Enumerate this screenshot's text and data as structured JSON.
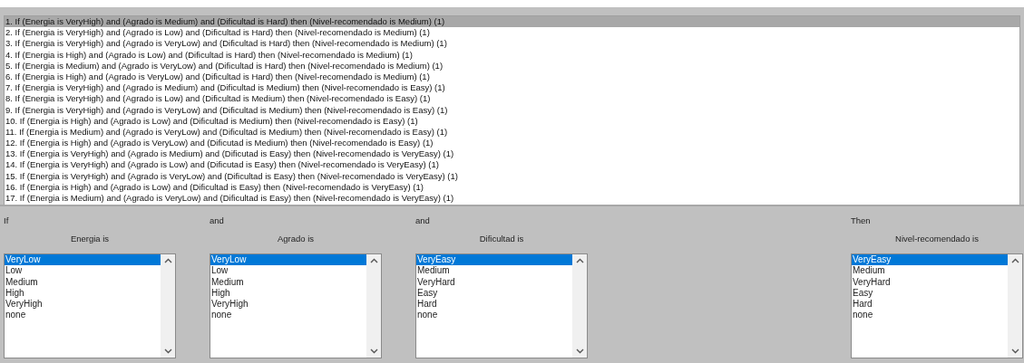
{
  "rules": [
    {
      "text": "1. If (Energia is VeryHigh) and (Agrado is Medium) and (Dificultad is Hard) then (Nivel-recomendado is Medium) (1)",
      "selected": true
    },
    {
      "text": "2. If (Energia is VeryHigh) and (Agrado is Low) and (Dificultad is Hard) then (Nivel-recomendado is Medium) (1)",
      "selected": false
    },
    {
      "text": "3. If (Energia is VeryHigh) and (Agrado is VeryLow) and (Dificultad is Hard) then (Nivel-recomendado is Medium) (1)",
      "selected": false
    },
    {
      "text": "4. If (Energia is High) and (Agrado is Low) and (Dificultad is Hard) then (Nivel-recomendado is Medium) (1)",
      "selected": false
    },
    {
      "text": "5. If (Energia is Medium) and (Agrado is VeryLow) and (Dificultad is Hard) then (Nivel-recomendado is Medium) (1)",
      "selected": false
    },
    {
      "text": "6. If (Energia is High) and (Agrado is VeryLow) and (Dificultad is Hard) then (Nivel-recomendado is Medium) (1)",
      "selected": false
    },
    {
      "text": "7. If (Energia is VeryHigh) and (Agrado is Medium) and (Dificultad is Medium) then (Nivel-recomendado is Easy) (1)",
      "selected": false
    },
    {
      "text": "8. If (Energia is VeryHigh) and (Agrado is Low) and (Dificultad is Medium) then (Nivel-recomendado is Easy) (1)",
      "selected": false
    },
    {
      "text": "9. If (Energia is VeryHigh) and (Agrado is VeryLow) and (Dificultad is Medium) then (Nivel-recomendado is Easy) (1)",
      "selected": false
    },
    {
      "text": "10. If (Energia is High) and (Agrado is Low) and (Dificultad is Medium) then (Nivel-recomendado is Easy) (1)",
      "selected": false
    },
    {
      "text": "11. If (Energia is Medium) and (Agrado is VeryLow) and (Dificultad is Medium) then (Nivel-recomendado is Easy) (1)",
      "selected": false
    },
    {
      "text": "12. If (Energia is High) and (Agrado is VeryLow) and (Dificutad is Medium) then (Nivel-recomendado is Easy) (1)",
      "selected": false
    },
    {
      "text": "13. If (Energia is VeryHigh) and (Agrado is Medium) and (Dificutad is Easy) then (Nivel-recomendado is VeryEasy) (1)",
      "selected": false
    },
    {
      "text": "14. If (Energia is VeryHigh) and (Agrado is Low) and (Dificutad is Easy) then (Nivel-recomendado is VeryEasy) (1)",
      "selected": false
    },
    {
      "text": "15. If (Energia is VeryHigh) and (Agrado is VeryLow) and (Dificultad is Easy) then (Nivel-recomendado is VeryEasy) (1)",
      "selected": false
    },
    {
      "text": "16. If (Energia is High) and (Agrado is Low) and (Dificultad is Easy) then (Nivel-recomendado is VeryEasy) (1)",
      "selected": false
    },
    {
      "text": "17. If (Energia is Medium) and (Agrado is VeryLow) and (Dificultad is Easy) then (Nivel-recomendado is VeryEasy) (1)",
      "selected": false
    }
  ],
  "columns": [
    {
      "connective": "If",
      "label": "Energia is",
      "options": [
        {
          "text": "VeryLow",
          "selected": true
        },
        {
          "text": "Low",
          "selected": false
        },
        {
          "text": "Medium",
          "selected": false
        },
        {
          "text": "High",
          "selected": false
        },
        {
          "text": "VeryHigh",
          "selected": false
        },
        {
          "text": "none",
          "selected": false
        }
      ]
    },
    {
      "connective": "and",
      "label": "Agrado is",
      "options": [
        {
          "text": "VeryLow",
          "selected": true
        },
        {
          "text": "Low",
          "selected": false
        },
        {
          "text": "Medium",
          "selected": false
        },
        {
          "text": "High",
          "selected": false
        },
        {
          "text": "VeryHigh",
          "selected": false
        },
        {
          "text": "none",
          "selected": false
        }
      ]
    },
    {
      "connective": "and",
      "label": "Dificultad is",
      "options": [
        {
          "text": "VeryEasy",
          "selected": true
        },
        {
          "text": "Medium",
          "selected": false
        },
        {
          "text": "VeryHard",
          "selected": false
        },
        {
          "text": "Easy",
          "selected": false
        },
        {
          "text": "Hard",
          "selected": false
        },
        {
          "text": "none",
          "selected": false
        }
      ]
    },
    {
      "connective": "Then",
      "label": "Nivel-recomendado is",
      "options": [
        {
          "text": "VeryEasy",
          "selected": true
        },
        {
          "text": "Medium",
          "selected": false
        },
        {
          "text": "VeryHard",
          "selected": false
        },
        {
          "text": "Easy",
          "selected": false
        },
        {
          "text": "Hard",
          "selected": false
        },
        {
          "text": "none",
          "selected": false
        }
      ]
    }
  ]
}
